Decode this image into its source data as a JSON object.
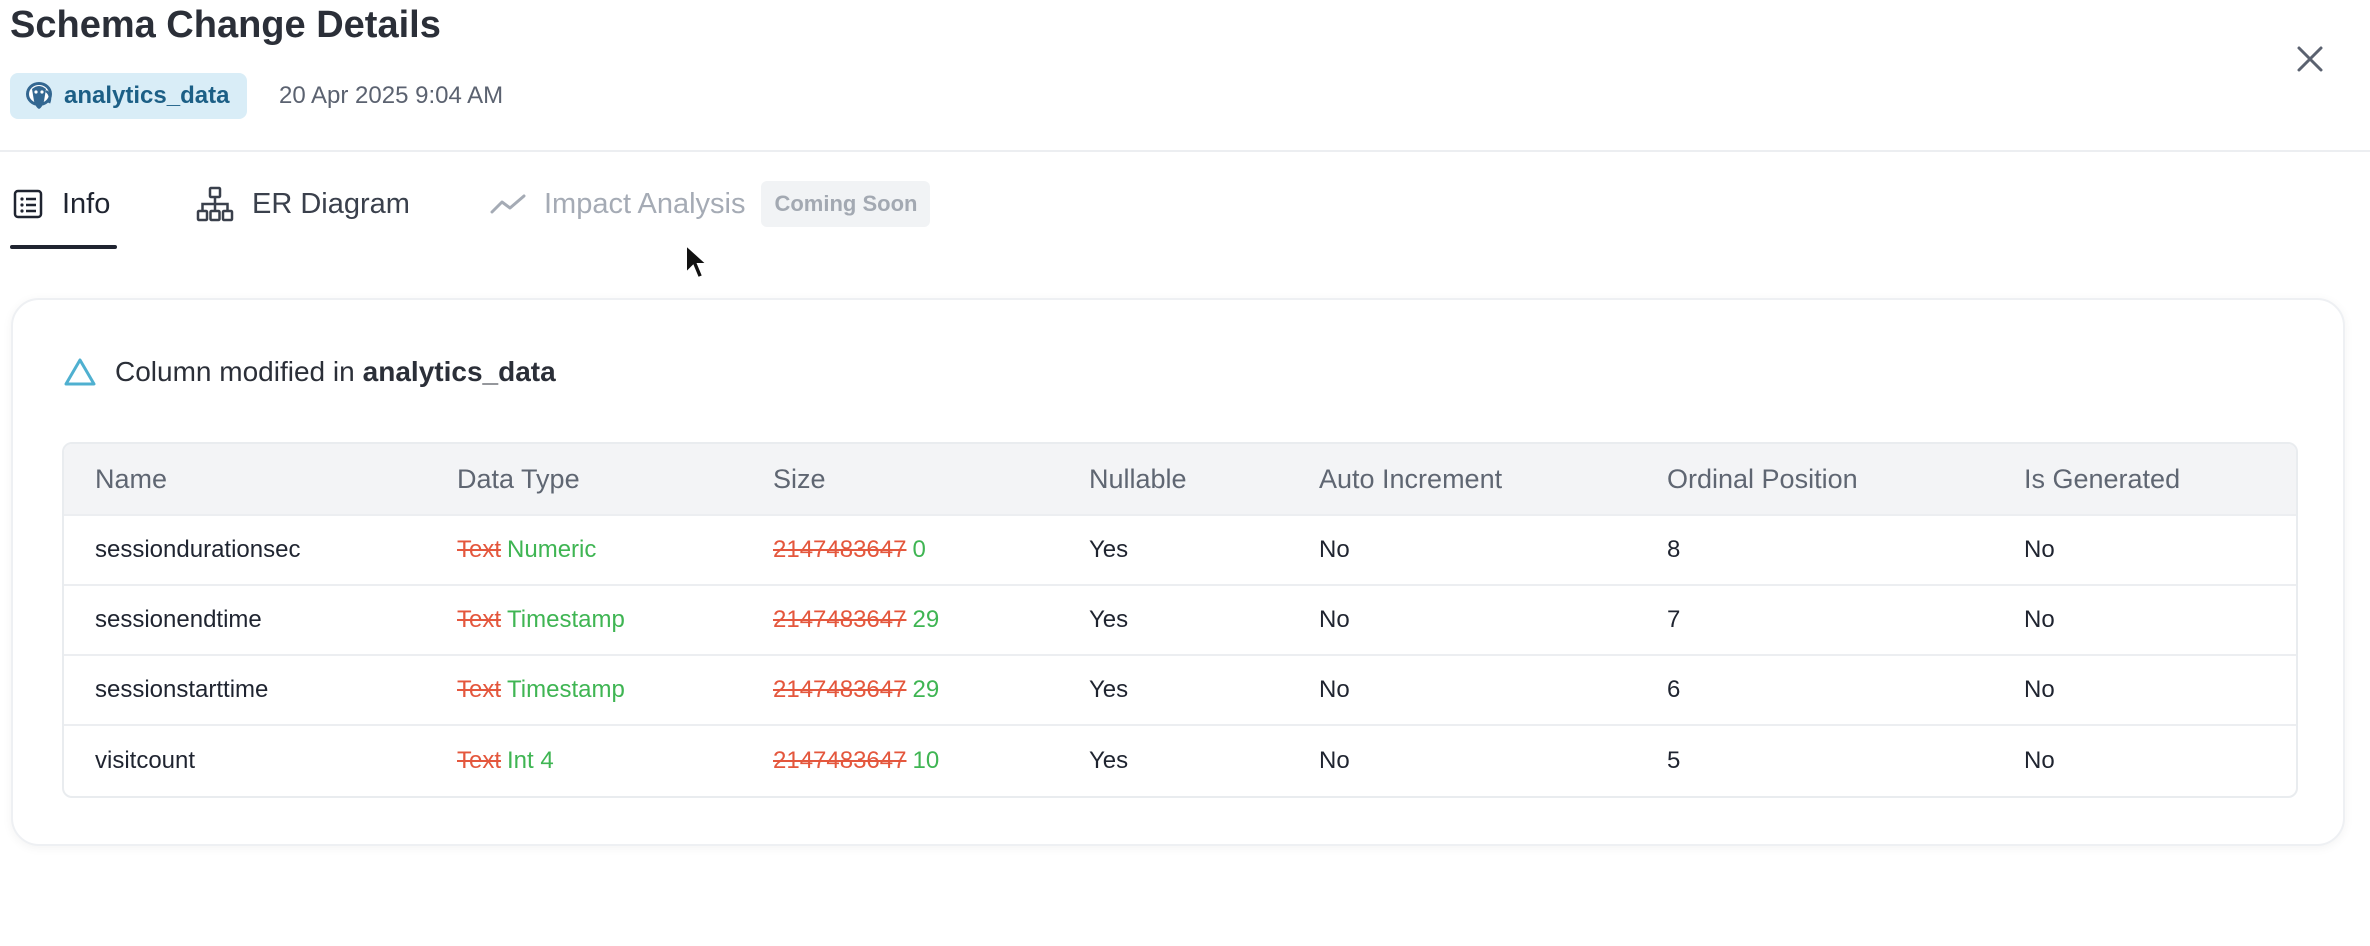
{
  "header": {
    "title": "Schema Change Details",
    "database": "analytics_data",
    "timestamp": "20 Apr 2025 9:04 AM",
    "close_icon": "close-icon"
  },
  "tabs": [
    {
      "label": "Info",
      "icon": "list-icon",
      "active": true
    },
    {
      "label": "ER Diagram",
      "icon": "hierarchy-icon",
      "active": false
    },
    {
      "label": "Impact Analysis",
      "icon": "trend-icon",
      "active": false,
      "badge": "Coming Soon",
      "disabled": true
    }
  ],
  "change": {
    "icon": "triangle-icon",
    "prefix": "Column modified in",
    "database": "analytics_data"
  },
  "table": {
    "columns": [
      "Name",
      "Data Type",
      "Size",
      "Nullable",
      "Auto Increment",
      "Ordinal Position",
      "Is Generated"
    ],
    "rows": [
      {
        "name": "sessiondurationsec",
        "type_old": "Text",
        "type_new": "Numeric",
        "size_old": "2147483647",
        "size_new": "0",
        "nullable": "Yes",
        "auto_increment": "No",
        "ordinal": "8",
        "generated": "No"
      },
      {
        "name": "sessionendtime",
        "type_old": "Text",
        "type_new": "Timestamp",
        "size_old": "2147483647",
        "size_new": "29",
        "nullable": "Yes",
        "auto_increment": "No",
        "ordinal": "7",
        "generated": "No"
      },
      {
        "name": "sessionstarttime",
        "type_old": "Text",
        "type_new": "Timestamp",
        "size_old": "2147483647",
        "size_new": "29",
        "nullable": "Yes",
        "auto_increment": "No",
        "ordinal": "6",
        "generated": "No"
      },
      {
        "name": "visitcount",
        "type_old": "Text",
        "type_new": "Int 4",
        "size_old": "2147483647",
        "size_new": "10",
        "nullable": "Yes",
        "auto_increment": "No",
        "ordinal": "5",
        "generated": "No"
      }
    ]
  },
  "colors": {
    "accent_dark": "#1f2430",
    "chip_bg": "#d9edf7",
    "chip_text": "#1c5f86",
    "removed": "#e4573d",
    "added": "#3fb553",
    "triangle": "#4fb0d0"
  }
}
